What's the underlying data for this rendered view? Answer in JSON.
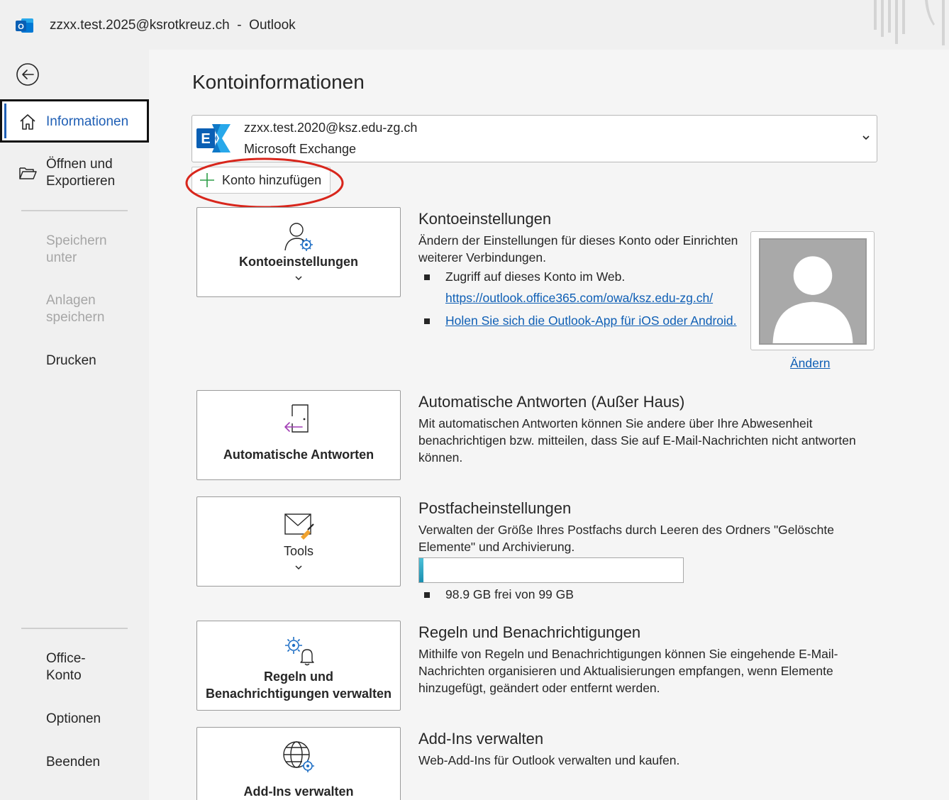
{
  "window": {
    "title": "zzxx.test.2025@ksrotkreuz.ch  -  Outlook"
  },
  "sidebar": {
    "items": [
      {
        "label": "Informationen"
      },
      {
        "label": "Öffnen und\nExportieren"
      },
      {
        "label": "Speichern\nunter"
      },
      {
        "label": "Anlagen\nspeichern"
      },
      {
        "label": "Drucken"
      },
      {
        "label": "Office-\nKonto"
      },
      {
        "label": "Optionen"
      },
      {
        "label": "Beenden"
      }
    ]
  },
  "main": {
    "title": "Kontoinformationen",
    "account": {
      "email": "zzxx.test.2020@ksz.edu-zg.ch",
      "type": "Microsoft Exchange"
    },
    "add_account_label": "Konto hinzufügen",
    "sections": {
      "account_settings": {
        "tile_label": "Kontoeinstellungen",
        "title": "Kontoeinstellungen",
        "text": "Ändern der Einstellungen für dieses Konto oder Einrichten weiterer Verbindungen.",
        "bullet1": "Zugriff auf dieses Konto im Web.",
        "link1": "https://outlook.office365.com/owa/ksz.edu-zg.ch/",
        "link2": "Holen Sie sich die Outlook-App für iOS oder Android.",
        "change_photo": "Ändern"
      },
      "auto_replies": {
        "tile_label": "Automatische Antworten",
        "title": "Automatische Antworten (Außer Haus)",
        "text": "Mit automatischen Antworten können Sie andere über Ihre Abwesenheit benachrichtigen bzw. mitteilen, dass Sie auf E-Mail-Nachrichten nicht antworten können."
      },
      "mailbox": {
        "tile_label": "Tools",
        "title": "Postfacheinstellungen",
        "text": "Verwalten der Größe Ihres Postfachs durch Leeren des Ordners \"Gelöschte Elemente\" und Archivierung.",
        "quota_text": "98.9 GB frei von 99 GB",
        "quota_used_fraction": 0.01
      },
      "rules": {
        "tile_label": "Regeln und\nBenachrichtigungen verwalten",
        "title": "Regeln und Benachrichtigungen",
        "text": "Mithilfe von Regeln und Benachrichtigungen können Sie eingehende E-Mail-Nachrichten organisieren und Aktualisierungen empfangen, wenn Elemente hinzugefügt, geändert oder entfernt werden."
      },
      "addins": {
        "tile_label": "Add-Ins verwalten",
        "title": "Add-Ins verwalten",
        "text": "Web-Add-Ins für Outlook verwalten und kaufen."
      }
    }
  },
  "colors": {
    "accent": "#1f5fb5",
    "link": "#0f5fb5",
    "annotation": "#d8261c"
  },
  "icons": {
    "app": "outlook-icon",
    "back": "back-arrow-icon",
    "home": "home-icon",
    "folder": "open-folder-icon",
    "account": "exchange-icon",
    "add": "plus-icon"
  }
}
